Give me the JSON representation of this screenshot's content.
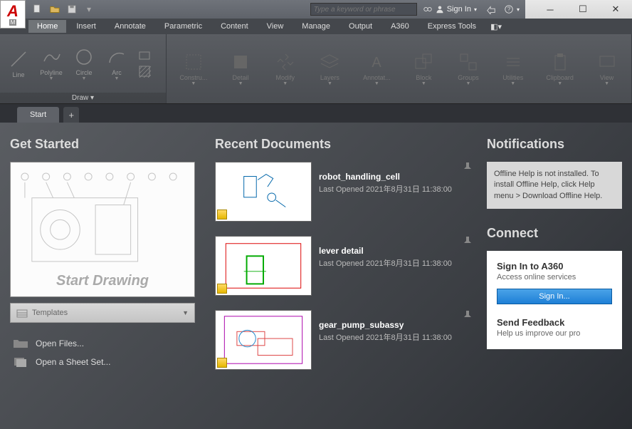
{
  "titlebar": {
    "search_placeholder": "Type a keyword or phrase",
    "signin_label": "Sign In"
  },
  "menubar": {
    "tabs": [
      "Home",
      "Insert",
      "Annotate",
      "Parametric",
      "Content",
      "View",
      "Manage",
      "Output",
      "A360",
      "Express Tools"
    ]
  },
  "ribbon": {
    "draw_label": "Draw ▾",
    "tools_draw": [
      {
        "label": "Line"
      },
      {
        "label": "Polyline"
      },
      {
        "label": "Circle"
      },
      {
        "label": "Arc"
      }
    ],
    "panels": [
      {
        "label": "Constru..."
      },
      {
        "label": "Detail"
      },
      {
        "label": "Modify"
      },
      {
        "label": "Layers"
      },
      {
        "label": "Annotat..."
      },
      {
        "label": "Block"
      },
      {
        "label": "Groups"
      },
      {
        "label": "Utilities"
      },
      {
        "label": "Clipboard"
      },
      {
        "label": "View"
      }
    ]
  },
  "tabbar": {
    "start": "Start"
  },
  "start": {
    "get_started": "Get Started",
    "start_drawing": "Start Drawing",
    "templates": "Templates",
    "open_files": "Open Files...",
    "open_sheet_set": "Open a Sheet Set..."
  },
  "recent": {
    "heading": "Recent Documents",
    "items": [
      {
        "title": "robot_handling_cell",
        "date": "Last Opened 2021年8月31日 11:38:00"
      },
      {
        "title": "lever detail",
        "date": "Last Opened 2021年8月31日 11:38:00"
      },
      {
        "title": "gear_pump_subassy",
        "date": "Last Opened 2021年8月31日 11:38:00"
      }
    ]
  },
  "notifications": {
    "heading": "Notifications",
    "text": "Offline Help is not installed. To install Offline Help, click Help menu > Download Offline Help."
  },
  "connect": {
    "heading": "Connect",
    "signin_h": "Sign In to A360",
    "signin_sub": "Access online services",
    "signin_btn": "Sign In...",
    "feedback_h": "Send Feedback",
    "feedback_sub": "Help us improve our pro"
  }
}
